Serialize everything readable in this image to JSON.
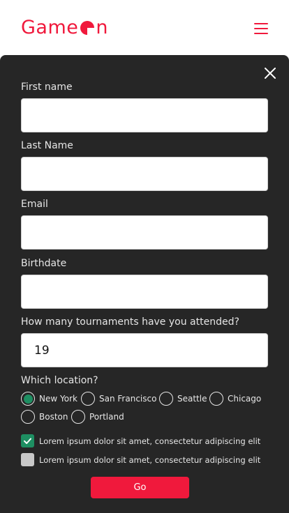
{
  "brand": {
    "name_prefix": "Game",
    "name_suffix": "n",
    "accent_color": "#f0193c"
  },
  "header": {
    "menu_icon": "hamburger-menu-icon"
  },
  "form": {
    "close_icon": "close-icon",
    "first_name": {
      "label": "First name",
      "value": ""
    },
    "last_name": {
      "label": "Last Name",
      "value": ""
    },
    "email": {
      "label": "Email",
      "value": ""
    },
    "birthdate": {
      "label": "Birthdate",
      "value": ""
    },
    "tournaments": {
      "label": "How many tournaments have you attended?",
      "value": "19"
    },
    "location": {
      "label": "Which location?",
      "selected": "New York",
      "options": [
        "New York",
        "San Francisco",
        "Seattle",
        "Chicago",
        "Boston",
        "Portland"
      ]
    },
    "checkboxes": [
      {
        "label": "Lorem ipsum dolor sit amet, consectetur adipiscing elit",
        "checked": true
      },
      {
        "label": "Lorem ipsum dolor sit amet, consectetur adipiscing elit",
        "checked": false
      }
    ],
    "submit_label": "Go",
    "check_color": "#1e8f62",
    "panel_color": "#262626"
  }
}
